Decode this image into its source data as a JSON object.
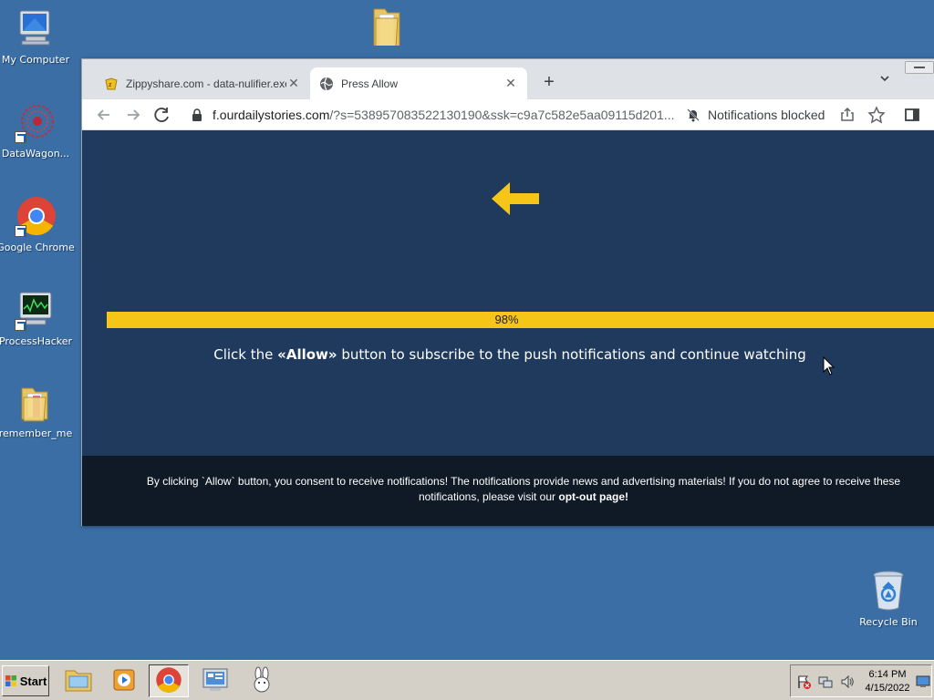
{
  "desktop": {
    "icons": [
      {
        "label": "My Computer",
        "icon": "my-computer-icon"
      },
      {
        "label": "DataWagon...",
        "icon": "datawagon-icon"
      },
      {
        "label": "Google Chrome",
        "icon": "chrome-icon"
      },
      {
        "label": "ProcessHacker",
        "icon": "processhacker-icon"
      },
      {
        "label": "remember_me",
        "icon": "folder-icon"
      },
      {
        "label": "Recycle Bin",
        "icon": "recycle-bin-icon"
      }
    ]
  },
  "browser": {
    "tabs": [
      {
        "title": "Zippyshare.com - data-nulifier.exe",
        "active": false
      },
      {
        "title": "Press Allow",
        "active": true
      }
    ],
    "url": {
      "domain": "f.ourdailystories.com",
      "rest": "/?s=538957083522130190&ssk=c9a7c582e5aa09115d201..."
    },
    "notifications_status": "Notifications blocked"
  },
  "page": {
    "progress_text": "98%",
    "progress_value": 0.98,
    "instruction_prefix": "Click the ",
    "instruction_bold": "«Allow»",
    "instruction_suffix": " button to subscribe to the push notifications and continue watching",
    "footer_text": "By clicking `Allow` button, you consent to receive notifications! The notifications provide news and advertising materials! If you do not agree to receive these notifications, please visit our ",
    "footer_link": "opt-out page",
    "footer_end": "!"
  },
  "taskbar": {
    "start_label": "Start",
    "time": "6:14 PM",
    "date": "4/15/2022"
  },
  "colors": {
    "page_bg": "#1f3a5c",
    "accent_yellow": "#f5c518",
    "desktop_bg": "#3a6ea5"
  }
}
